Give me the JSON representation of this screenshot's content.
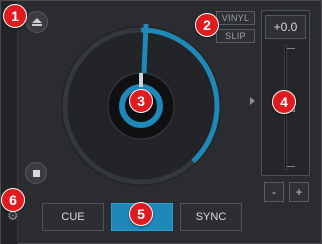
{
  "deck": {
    "mode_buttons": {
      "vinyl": "VINYL",
      "slip": "SLIP"
    },
    "pitch": {
      "value": "+0.0",
      "minus": "-",
      "plus": "+",
      "level": 0.5
    },
    "transport": {
      "cue": "CUE",
      "play": "",
      "sync": "SYNC"
    },
    "accent_color": "#1e88b8",
    "icons": [
      "eject-icon",
      "stop-icon",
      "gear-icon",
      "pitch-arrow-icon"
    ],
    "platter": {
      "progress": 0.38
    }
  },
  "callouts": [
    "1",
    "2",
    "3",
    "4",
    "5",
    "6"
  ]
}
